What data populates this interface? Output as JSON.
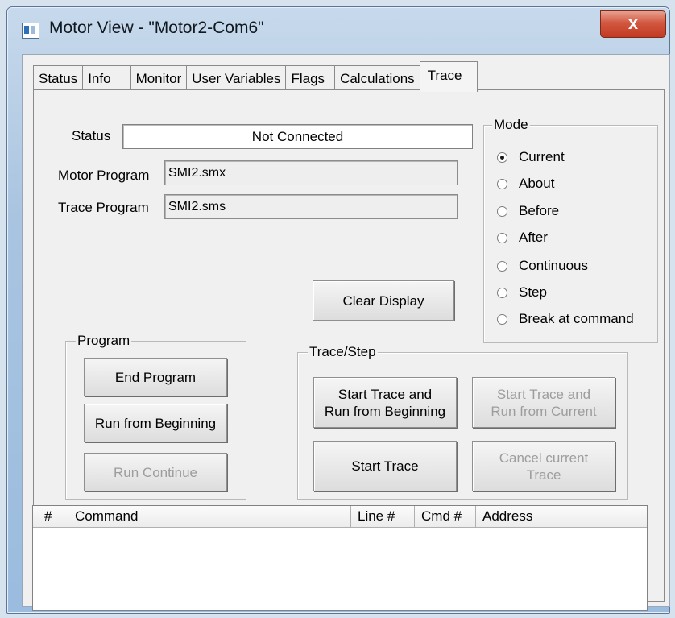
{
  "window": {
    "title": "Motor View - \"Motor2-Com6\"",
    "close_label": "x"
  },
  "tabs": [
    "Status",
    "Info",
    "Monitor",
    "User Variables",
    "Flags",
    "Calculations",
    "Trace"
  ],
  "active_tab": "Trace",
  "fields": {
    "status_label": "Status",
    "status_value": "Not Connected",
    "motor_program_label": "Motor Program",
    "motor_program_value": "SMI2.smx",
    "trace_program_label": "Trace Program",
    "trace_program_value": "SMI2.sms"
  },
  "mode": {
    "title": "Mode",
    "options": [
      "Current",
      "About",
      "Before",
      "After",
      "Continuous",
      "Step",
      "Break at command"
    ],
    "selected": "Current"
  },
  "buttons": {
    "clear_display": "Clear Display",
    "end_program": "End Program",
    "run_from_beginning": "Run from Beginning",
    "run_continue": "Run Continue",
    "start_trace_run_beginning": "Start Trace and\nRun from Beginning",
    "start_trace_run_current": "Start Trace and\nRun from Current",
    "start_trace": "Start Trace",
    "cancel_trace": "Cancel current\nTrace"
  },
  "groups": {
    "program": "Program",
    "trace_step": "Trace/Step"
  },
  "table": {
    "columns": [
      "#",
      "Command",
      "Line #",
      "Cmd #",
      "Address"
    ],
    "rows": []
  }
}
